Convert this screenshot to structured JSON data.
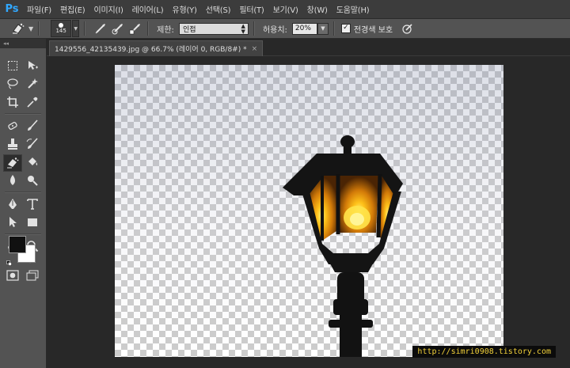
{
  "app": {
    "logo": "Ps"
  },
  "menu": [
    "파일(F)",
    "편집(E)",
    "이미지(I)",
    "레이어(L)",
    "유형(Y)",
    "선택(S)",
    "필터(T)",
    "보기(V)",
    "창(W)",
    "도움말(H)"
  ],
  "options": {
    "brush_size": "145",
    "limit_label": "제한:",
    "limit_value": "인접",
    "tolerance_label": "허용치:",
    "tolerance_value": "20%",
    "protect_label": "전경색 보호",
    "protect_checked": true
  },
  "document": {
    "tab_title": "1429556_42135439.jpg @ 66.7% (레이어 0, RGB/8#) *",
    "close_glyph": "×"
  },
  "tools": {
    "collapse_glyph": "◂◂",
    "foreground_color": "#111111",
    "background_color": "#ffffff"
  },
  "watermark": "http://simri0908.tistory.com",
  "colors": {
    "accent": "#31a8ff",
    "panel": "#535353",
    "workspace": "#282828",
    "watermark_text": "#f2d13a"
  }
}
